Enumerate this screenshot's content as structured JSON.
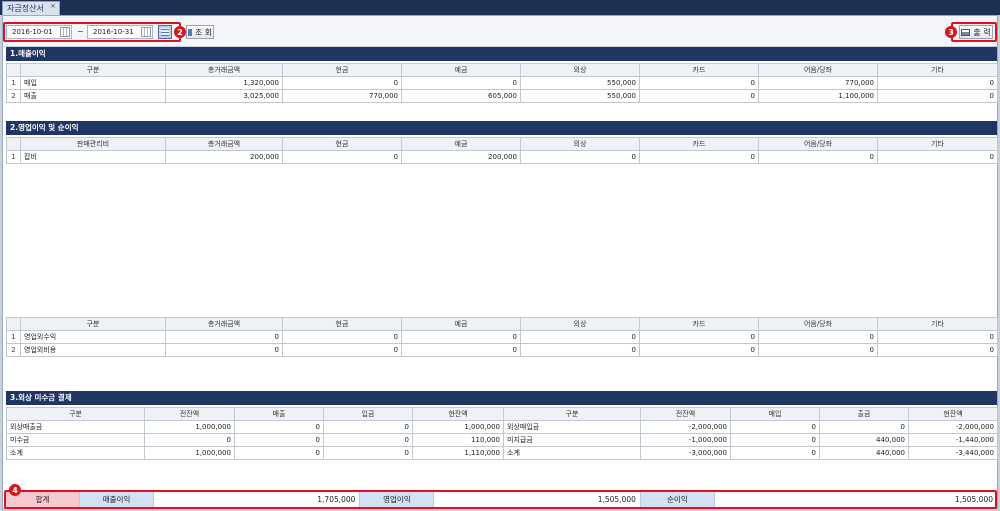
{
  "tab": {
    "title": "자금정산서",
    "close": "×"
  },
  "toolbar": {
    "date_from": "2016-10-01",
    "tilde": "~",
    "date_to": "2016-10-31",
    "search_label": "조 회",
    "print_label": "출 력"
  },
  "markers": {
    "m2": "2",
    "m3": "3",
    "m4": "4"
  },
  "sections": {
    "s1": "1.매출이익",
    "s2": "2.영업이익 및 순이익",
    "s3": "3.외상 미수금 결제"
  },
  "cols": {
    "c1": "구분",
    "c2": "총거래금액",
    "c3": "현금",
    "c4": "예금",
    "c5": "외상",
    "c6": "카드",
    "c7": "어음/당좌",
    "c8": "기타",
    "sga": "판매관리비"
  },
  "t1": {
    "rows": [
      [
        "1",
        "매입",
        "1,320,000",
        "0",
        "0",
        "550,000",
        "0",
        "770,000",
        "0"
      ],
      [
        "2",
        "매출",
        "3,025,000",
        "770,000",
        "605,000",
        "550,000",
        "0",
        "1,100,000",
        "0"
      ]
    ]
  },
  "t2": {
    "rows": [
      [
        "1",
        "잡비",
        "200,000",
        "0",
        "200,000",
        "0",
        "0",
        "0",
        "0"
      ]
    ]
  },
  "t3": {
    "rows": [
      [
        "1",
        "영업외수익",
        "0",
        "0",
        "0",
        "0",
        "0",
        "0",
        "0"
      ],
      [
        "2",
        "영업외비용",
        "0",
        "0",
        "0",
        "0",
        "0",
        "0",
        "0"
      ]
    ]
  },
  "t4": {
    "headers": [
      "구분",
      "전잔액",
      "매출",
      "입금",
      "현잔액",
      "구분",
      "전잔액",
      "매입",
      "출금",
      "현잔액"
    ],
    "rows": [
      [
        "외상매출금",
        "1,000,000",
        "0",
        "0",
        "1,000,000",
        "외상매입금",
        "-2,000,000",
        "0",
        "0",
        "-2,000,000"
      ],
      [
        "미수금",
        "0",
        "0",
        "0",
        "110,000",
        "미지급금",
        "-1,000,000",
        "0",
        "440,000",
        "-1,440,000"
      ],
      [
        "소계",
        "1,000,000",
        "0",
        "0",
        "1,110,000",
        "소계",
        "-3,000,000",
        "0",
        "440,000",
        "-3,440,000"
      ]
    ]
  },
  "summary": {
    "total_label": "합계",
    "sales_profit_label": "매출이익",
    "sales_profit": "1,705,000",
    "op_profit_label": "영업이익",
    "op_profit": "1,505,000",
    "net_profit_label": "순이익",
    "net_profit": "1,505,000"
  }
}
